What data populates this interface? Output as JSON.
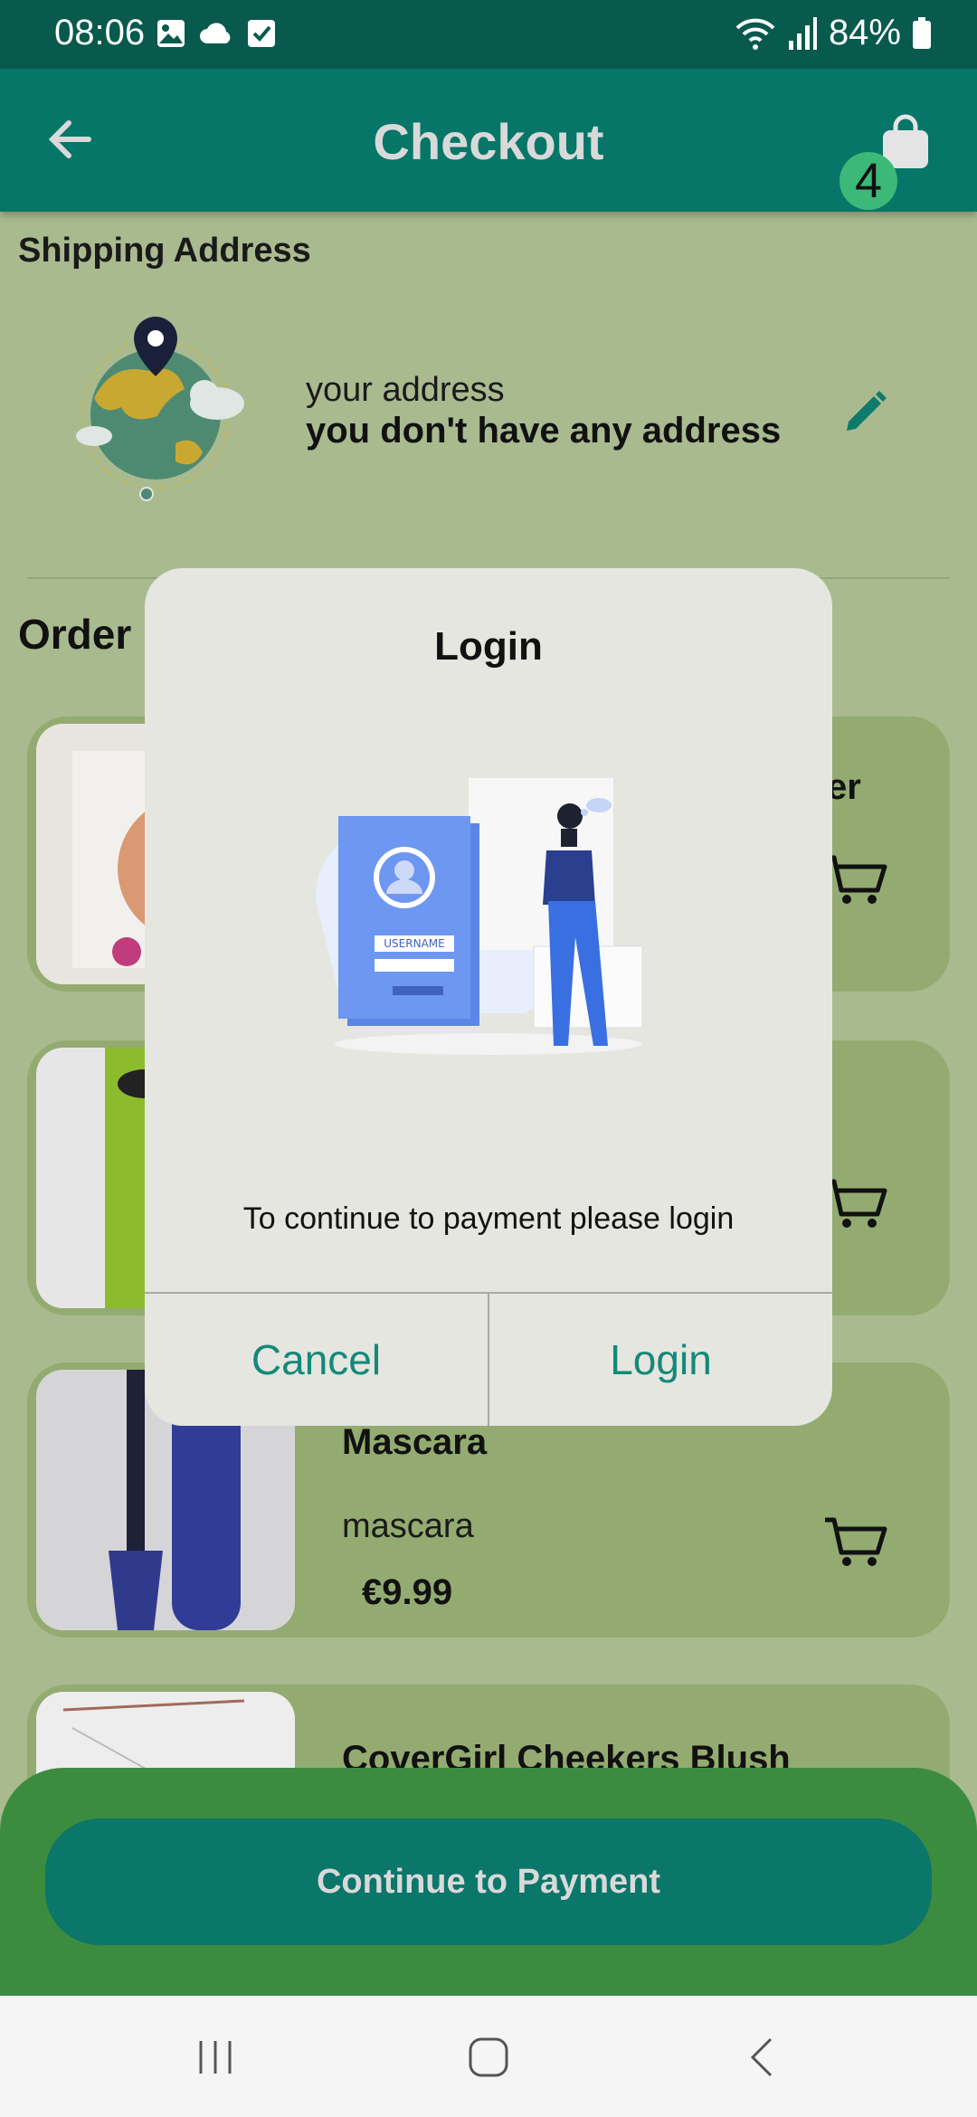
{
  "status_bar": {
    "time": "08:06",
    "battery": "84%",
    "icons": [
      "image-icon",
      "cloud-icon",
      "checkbox-icon",
      "wifi-icon",
      "signal-icon",
      "battery-icon"
    ]
  },
  "app_bar": {
    "title": "Checkout",
    "cart_badge": "4"
  },
  "shipping": {
    "heading": "Shipping Address",
    "address_label": "your address",
    "address_value": "you don't have any address"
  },
  "order": {
    "heading": "Order I",
    "items": [
      {
        "name": "",
        "category": "",
        "price": ""
      },
      {
        "name": "",
        "category": "",
        "price": ""
      },
      {
        "name": "Mascara",
        "category": "mascara",
        "price": "€9.99"
      },
      {
        "name": "CoverGirl Cheekers Blush",
        "category": "",
        "price": ""
      }
    ],
    "partial_text": "er"
  },
  "actions": {
    "continue_label": "Continue to Payment"
  },
  "dialog": {
    "title": "Login",
    "message": "To continue to payment please login",
    "cancel_label": "Cancel",
    "login_label": "Login",
    "illustration_text": "USERNAME"
  },
  "colors": {
    "status_bar": "#075a4c",
    "app_bar": "#067668",
    "background": "#a9ba8f",
    "card": "#93ab70",
    "bottom_panel": "#3c8c3f",
    "primary_button": "#0b766a",
    "dialog_button_text": "#14897a",
    "badge": "#3cb878"
  }
}
